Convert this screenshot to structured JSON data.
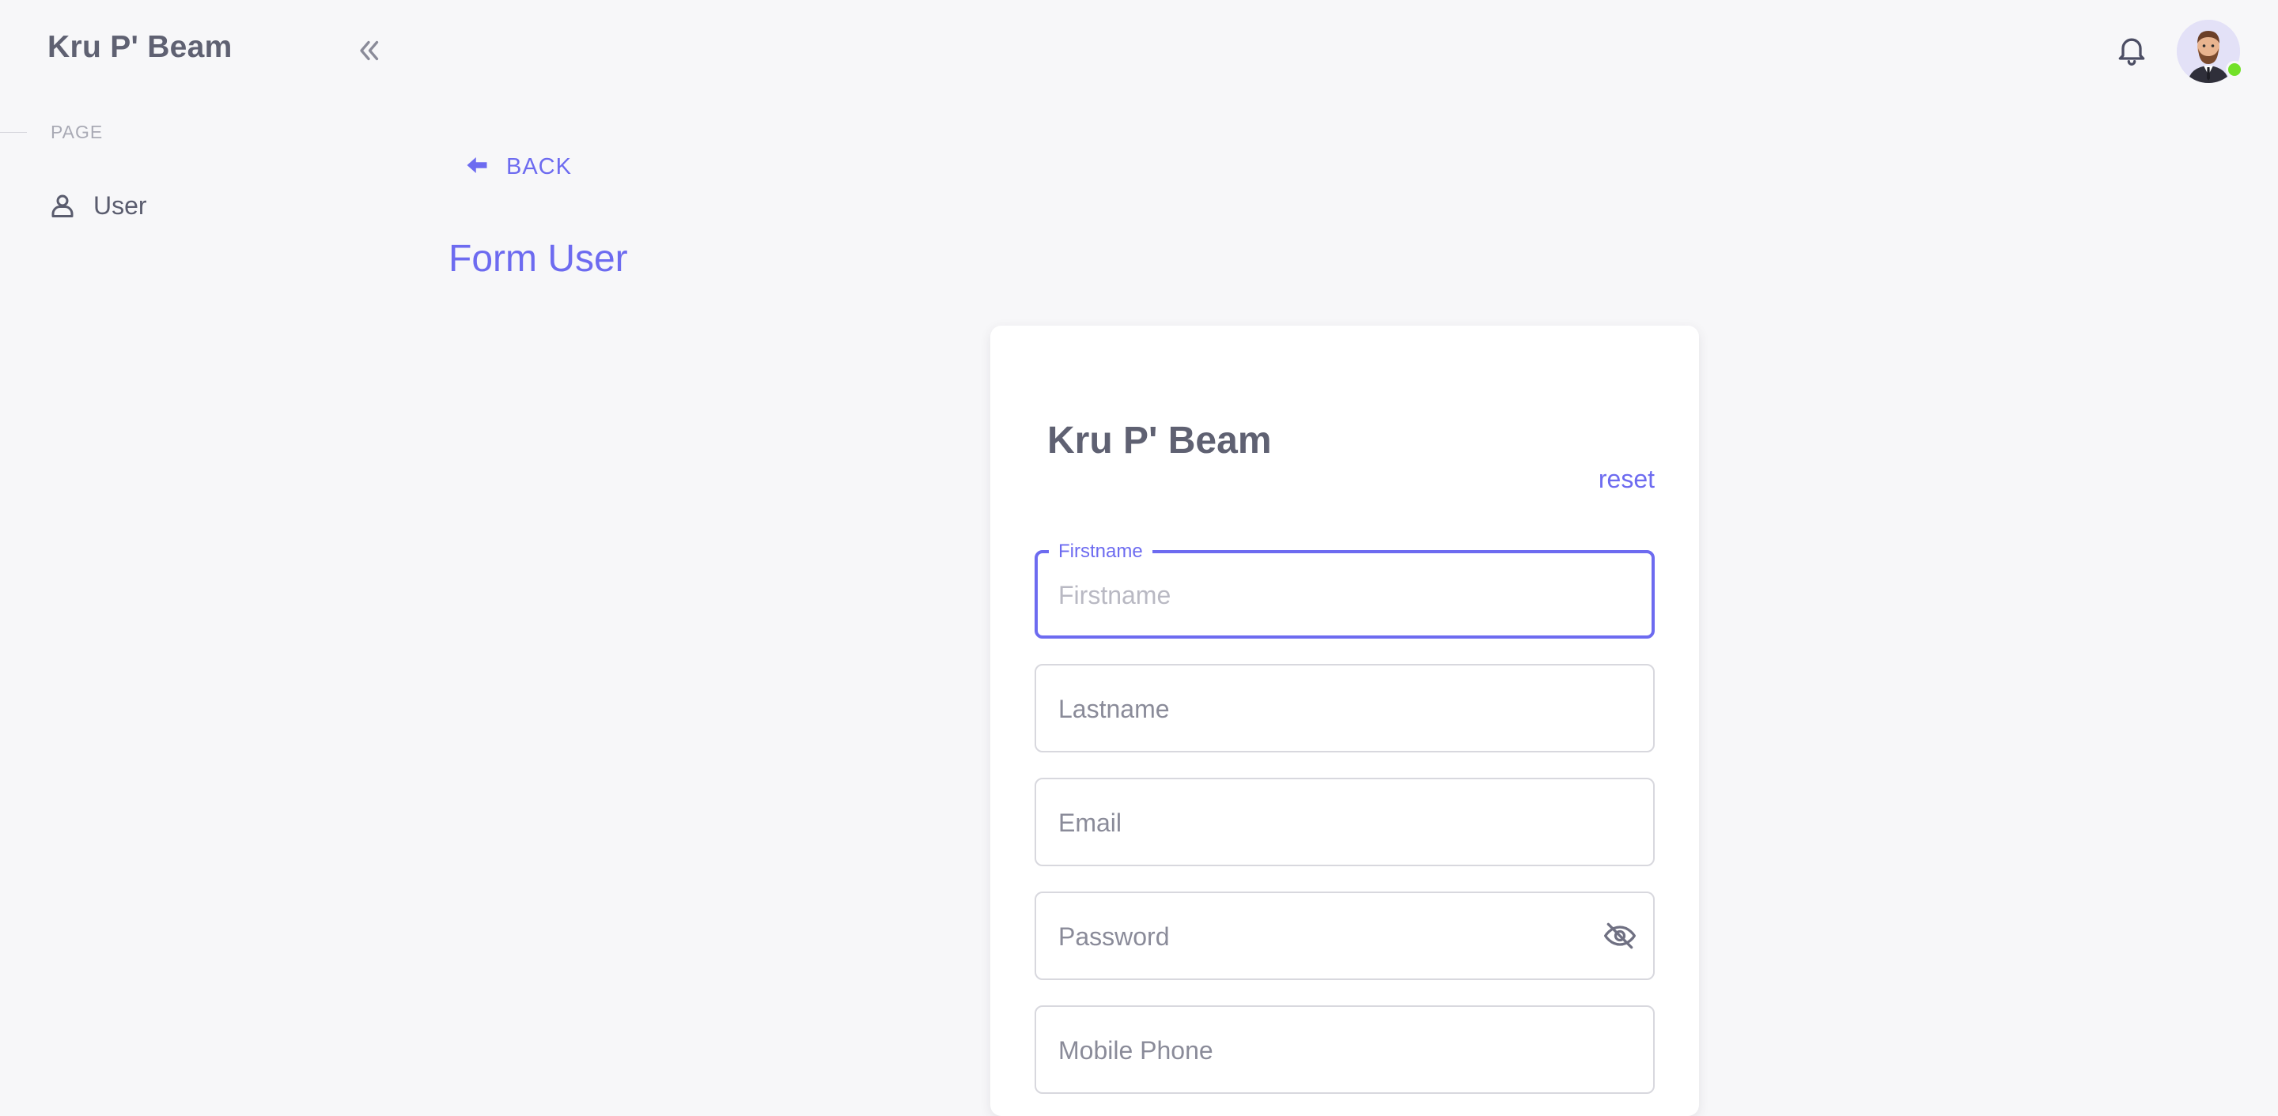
{
  "app": {
    "brand": "Kru P' Beam"
  },
  "sidebar": {
    "section_title": "PAGE",
    "items": [
      {
        "label": "User",
        "icon": "user-icon"
      }
    ]
  },
  "header": {
    "notification_icon": "bell-icon",
    "avatar_status": "online"
  },
  "main": {
    "back_label": "BACK",
    "page_title": "Form User"
  },
  "card": {
    "title": "Kru P' Beam",
    "reset_label": "reset",
    "fields": {
      "firstname": {
        "label": "Firstname",
        "placeholder": "Firstname",
        "value": ""
      },
      "lastname": {
        "placeholder": "Lastname",
        "value": ""
      },
      "email": {
        "placeholder": "Email",
        "value": ""
      },
      "password": {
        "placeholder": "Password",
        "value": ""
      },
      "mobile": {
        "placeholder": "Mobile Phone",
        "value": ""
      }
    }
  },
  "colors": {
    "accent": "#6d6bf0",
    "background": "#f7f7f9",
    "text": "#5f6172",
    "online": "#72e128"
  }
}
